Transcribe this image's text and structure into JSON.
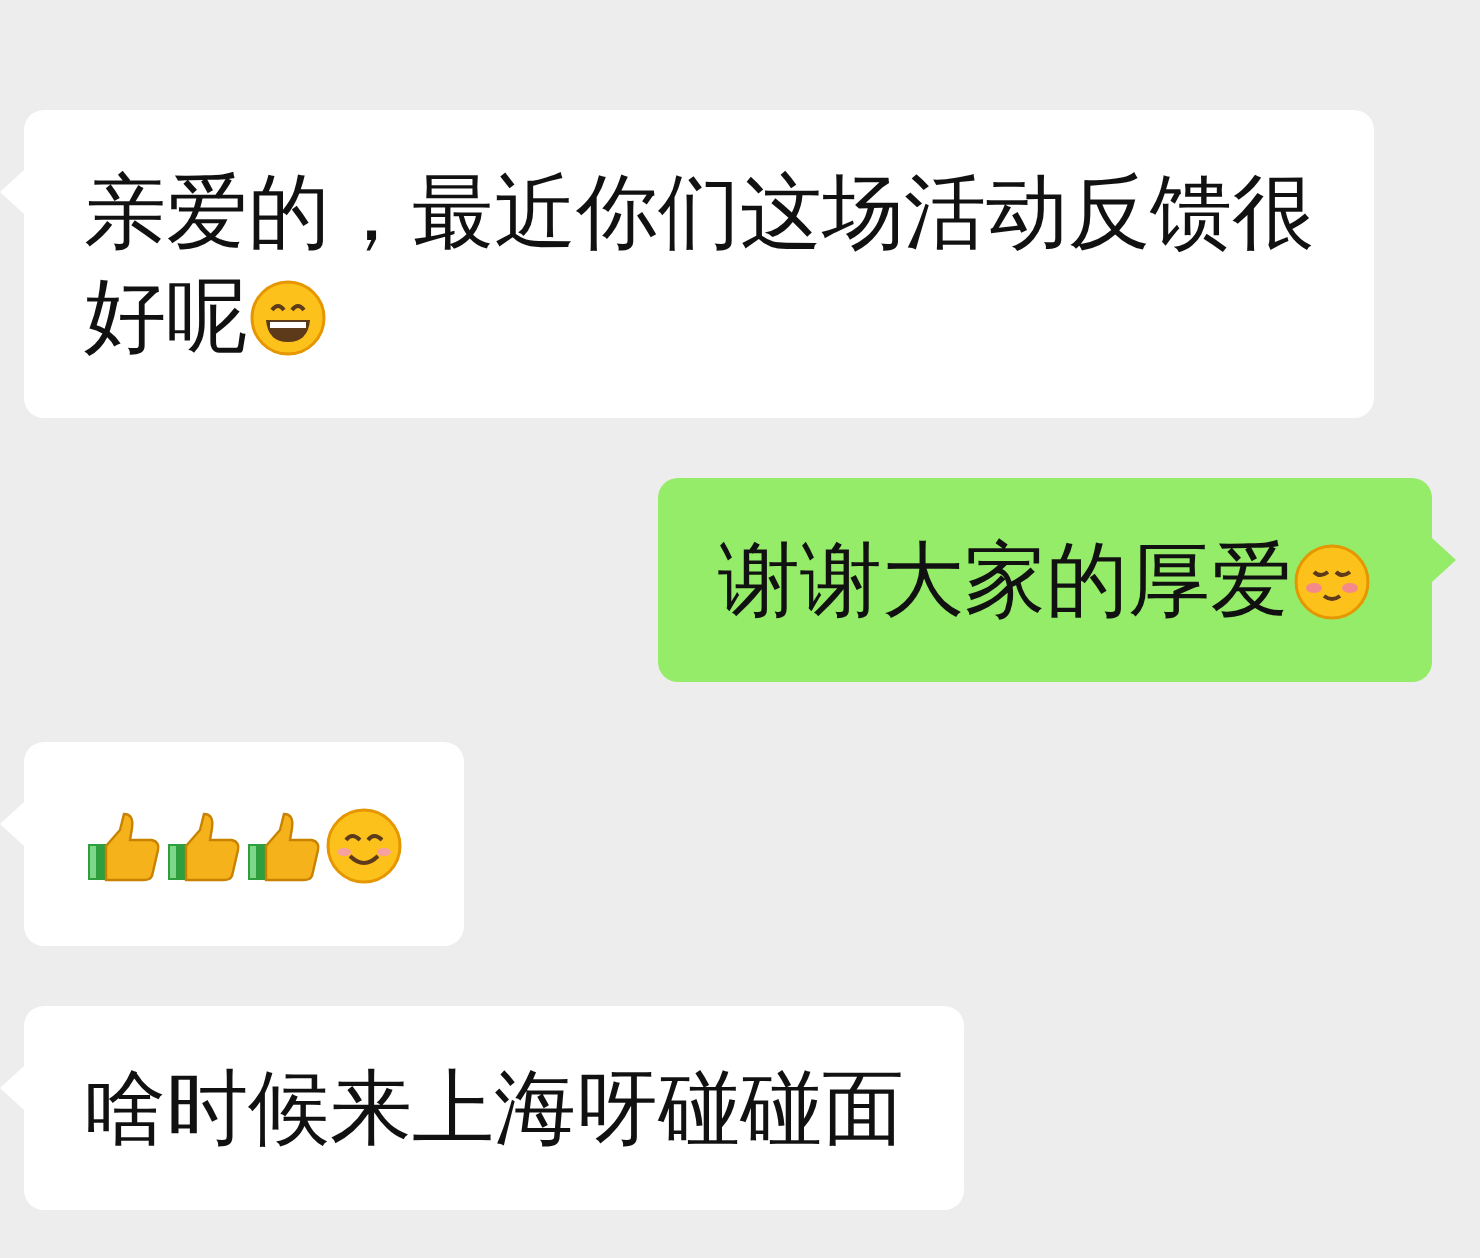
{
  "messages": [
    {
      "kind": "received",
      "lines": [
        "亲爱的，最近你们这场活动反馈很",
        "好呢"
      ],
      "emojis": [
        {
          "kind": "grin"
        }
      ]
    },
    {
      "kind": "sent",
      "lines": [
        "谢谢大家的厚爱"
      ],
      "emojis": [
        {
          "kind": "blush"
        }
      ]
    },
    {
      "kind": "received",
      "emojis": [
        {
          "kind": "thumbs-up"
        },
        {
          "kind": "thumbs-up"
        },
        {
          "kind": "thumbs-up"
        },
        {
          "kind": "smile"
        }
      ]
    },
    {
      "kind": "received",
      "lines": [
        "啥时候来上海呀碰碰面"
      ]
    }
  ]
}
